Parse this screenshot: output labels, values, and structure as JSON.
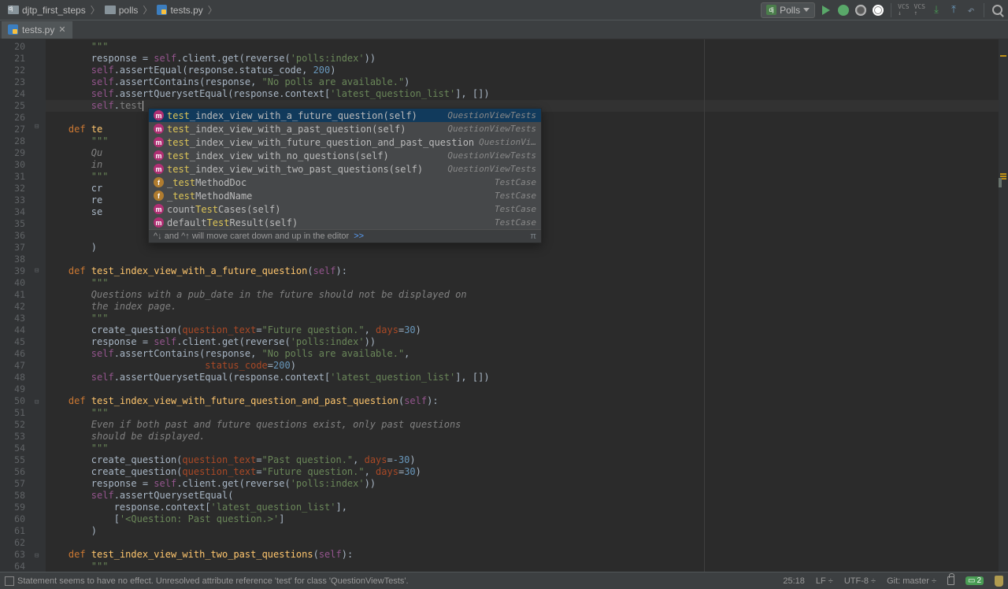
{
  "breadcrumbs": {
    "root": "djtp_first_steps",
    "folder": "polls",
    "file": "tests.py"
  },
  "run_config": "Polls",
  "tab": {
    "name": "tests.py"
  },
  "gutter_start": 20,
  "gutter_end": 64,
  "caret_line_typed": "self.test",
  "completion": {
    "items": [
      {
        "icon": "m",
        "name": "test_index_view_with_a_future_question(self)",
        "right": "QuestionViewTests",
        "hl": "test"
      },
      {
        "icon": "m",
        "name": "test_index_view_with_a_past_question(self)",
        "right": "QuestionViewTests",
        "hl": "test"
      },
      {
        "icon": "m",
        "name": "test_index_view_with_future_question_and_past_question",
        "right": "QuestionVi…",
        "hl": "test"
      },
      {
        "icon": "m",
        "name": "test_index_view_with_no_questions(self)",
        "right": "QuestionViewTests",
        "hl": "test"
      },
      {
        "icon": "m",
        "name": "test_index_view_with_two_past_questions(self)",
        "right": "QuestionViewTests",
        "hl": "test"
      },
      {
        "icon": "f",
        "name": "_testMethodDoc",
        "right": "TestCase",
        "hl": "test"
      },
      {
        "icon": "f",
        "name": "_testMethodName",
        "right": "TestCase",
        "hl": "test"
      },
      {
        "icon": "m",
        "name": "countTestCases(self)",
        "right": "TestCase",
        "hl": "Test"
      },
      {
        "icon": "m",
        "name": "defaultTestResult(self)",
        "right": "TestCase",
        "hl": "Test"
      }
    ],
    "footer": "^↓ and ^↑ will move caret down and up in the editor",
    "footer_link": ">>"
  },
  "status": {
    "message": "Statement seems to have no effect. Unresolved attribute reference 'test' for class 'QuestionViewTests'.",
    "pos": "25:18",
    "line_sep": "LF",
    "encoding": "UTF-8",
    "git": "Git: master",
    "badge": "2"
  }
}
